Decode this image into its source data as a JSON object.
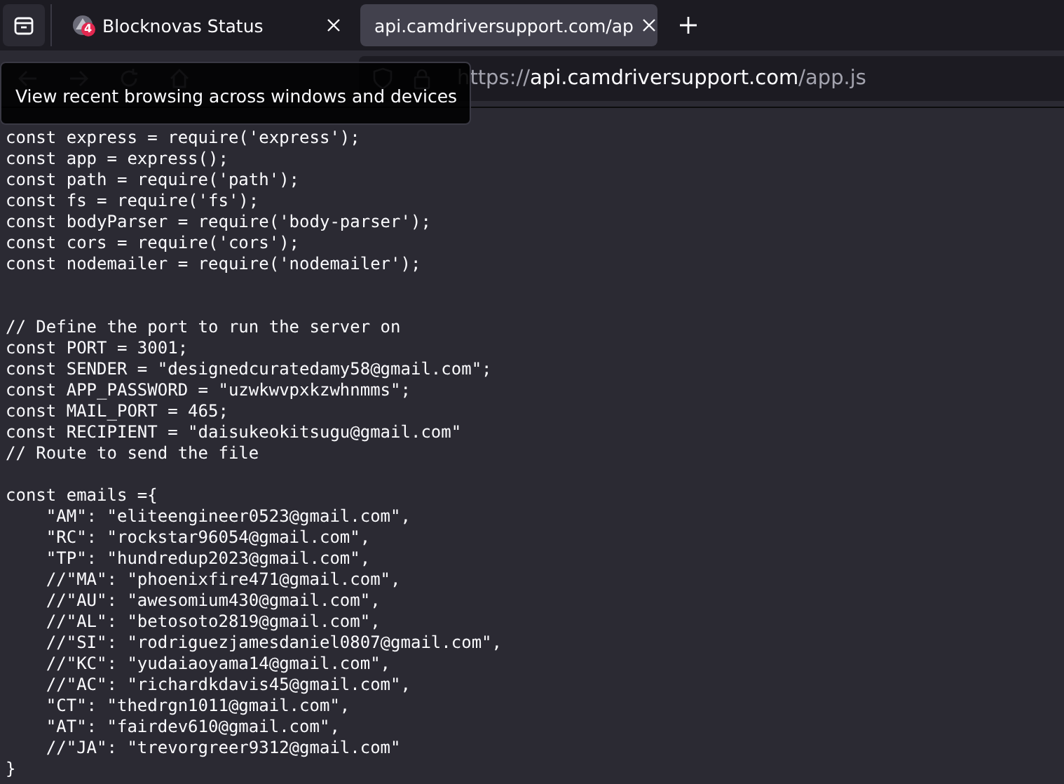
{
  "tabs": [
    {
      "title": "Blocknovas Status",
      "badge": "4",
      "selected": false
    },
    {
      "title": "api.camdriversupport.com/ap",
      "selected": true
    }
  ],
  "address_bar": {
    "scheme": "https://",
    "host": "api.camdriversupport.com",
    "path": "/app.js"
  },
  "tooltip": "View recent browsing across windows and devices",
  "code_lines": [
    {
      "kind": "code",
      "text": "const express = require('express');"
    },
    {
      "kind": "code",
      "text": "const app = express();"
    },
    {
      "kind": "code",
      "text": "const path = require('path');"
    },
    {
      "kind": "code",
      "text": "const fs = require('fs');"
    },
    {
      "kind": "code",
      "text": "const bodyParser = require('body-parser');"
    },
    {
      "kind": "code",
      "text": "const cors = require('cors');"
    },
    {
      "kind": "code",
      "text": "const nodemailer = require('nodemailer');"
    },
    {
      "kind": "blank"
    },
    {
      "kind": "blank"
    },
    {
      "kind": "code",
      "text": "// Define the port to run the server on"
    },
    {
      "kind": "code",
      "text": "const PORT = 3001;"
    },
    {
      "kind": "code",
      "text": "const SENDER = \"designedcuratedamy58@gmail.com\";"
    },
    {
      "kind": "code",
      "text": "const APP_PASSWORD = \"uzwkwvpxkzwhnmms\";"
    },
    {
      "kind": "code",
      "text": "const MAIL_PORT = 465;"
    },
    {
      "kind": "code",
      "text": "const RECIPIENT = \"daisukeokitsugu@gmail.com\""
    },
    {
      "kind": "code",
      "text": "// Route to send the file"
    },
    {
      "kind": "blank"
    },
    {
      "kind": "code",
      "text": "const emails ={"
    },
    {
      "kind": "code",
      "text": "    \"AM\": \"eliteengineer0523@gmail.com\","
    },
    {
      "kind": "code",
      "text": "    \"RC\": \"rockstar96054@gmail.com\","
    },
    {
      "kind": "code",
      "text": "    \"TP\": \"hundredup2023@gmail.com\","
    },
    {
      "kind": "code",
      "text": "    //\"MA\": \"phoenixfire471@gmail.com\","
    },
    {
      "kind": "code",
      "text": "    //\"AU\": \"awesomium430@gmail.com\","
    },
    {
      "kind": "code",
      "text": "    //\"AL\": \"betosoto2819@gmail.com\","
    },
    {
      "kind": "code",
      "text": "    //\"SI\": \"rodriguezjamesdaniel0807@gmail.com\","
    },
    {
      "kind": "code",
      "text": "    //\"KC\": \"yudaiaoyama14@gmail.com\","
    },
    {
      "kind": "code",
      "text": "    //\"AC\": \"richardkdavis45@gmail.com\","
    },
    {
      "kind": "code",
      "text": "    \"CT\": \"thedrgn1011@gmail.com\","
    },
    {
      "kind": "code",
      "text": "    \"AT\": \"fairdev610@gmail.com\","
    },
    {
      "kind": "code",
      "text": "    //\"JA\": \"trevorgreer9312@gmail.com\""
    },
    {
      "kind": "code",
      "text": "}"
    }
  ]
}
